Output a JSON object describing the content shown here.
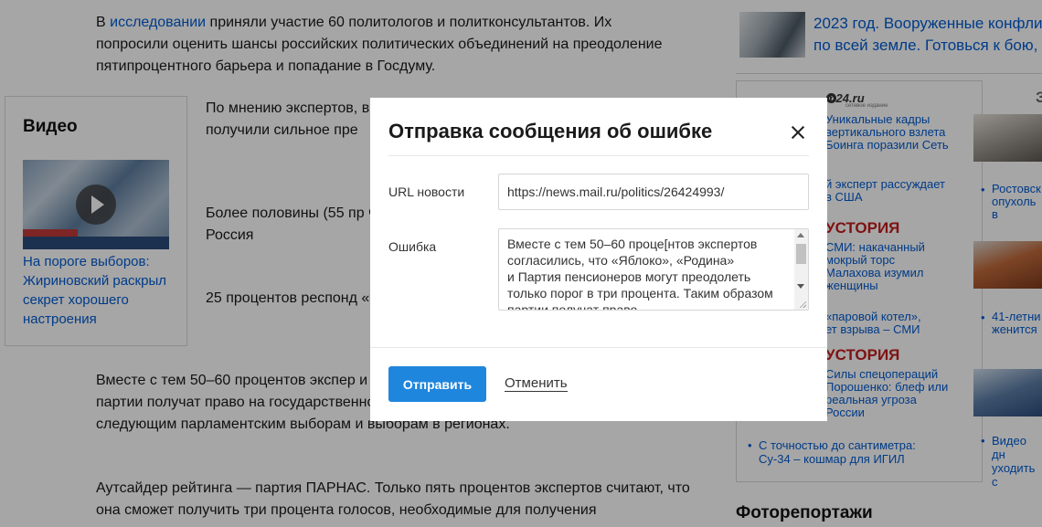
{
  "article": {
    "p1_prefix": "В ",
    "p1_link": "исследовании",
    "p1_rest": " приняли участие 60 политологов и политконсультантов. Их попросили оценить шансы российских политических объединений на преодоление пятипроцентного барьера и попадание в Госдуму.",
    "p2": "По мнению экспертов, в Думу имеет «Единая предвыборной кампан получили сильное пре",
    "p3": "Более половины (55 пр что места в нижней па «Справедливая Россия",
    "p4": "25 процентов респонд «Родина». Кроме того, прохождение в нижни",
    "p5": "Вместе с тем 50–60 процентов экспер и Партия пенсионеров могут преодол образом партии получат право на государственное финансирование и будут допущены к следующим парламентским выборам и выборам в регионах.",
    "p6": "Аутсайдер рейтинга — партия ПАРНАС. Только пять процентов экспертов считают, что она сможет получить три процента голосов, необходимые для получения"
  },
  "video": {
    "title": "Видео",
    "caption": "На пороге выборов: Жириновский раскрыл секрет хорошего настроения"
  },
  "right_rail": {
    "top_headline_1": "2023 год. Вооруженные конфли",
    "top_headline_2": "по всей земле. Готовься к бою,",
    "corner_mark": "З",
    "m24_logo": "m24.ru",
    "m24_sub": "сетевое издание",
    "item1": "Уникальные кадры\nвертикального взлета\nБоинга поразили Сеть",
    "item2": "й эксперт рассуждает\nв США",
    "story1": "УСТОРИЯ",
    "item3": "СМИ: накачанный\nмокрый торс\nМалахова изумил\nженщины",
    "item4": "«паровой котел»,\nет взрыва – СМИ",
    "story2": "УСТОРИЯ",
    "item5": "Силы спецопераций\nПорошенко: блеф или\nреальная угроза\nРоссии",
    "right_item1": "Ростовск\nопухоль в",
    "right_item2": "41-летни\nженится",
    "bottom_item": "С точностью до сантиметра:\nСу-34 – кошмар для ИГИЛ",
    "bottom_item2": "Видео дн\nуходить с",
    "photo_section": "Фоторепортажи"
  },
  "modal": {
    "title": "Отправка сообщения об ошибке",
    "url_label": "URL новости",
    "url_value": "https://news.mail.ru/politics/26424993/",
    "error_label": "Ошибка",
    "error_text": "Вместе с тем 50–60 проце[нтов экспертов согласились, что «Яблоко», «Родина»\nи Партия пенсионеров могут преодолеть только порог в три процента. Таким образом партии получат право",
    "send_label": "Отправить",
    "cancel_label": "Отменить"
  }
}
